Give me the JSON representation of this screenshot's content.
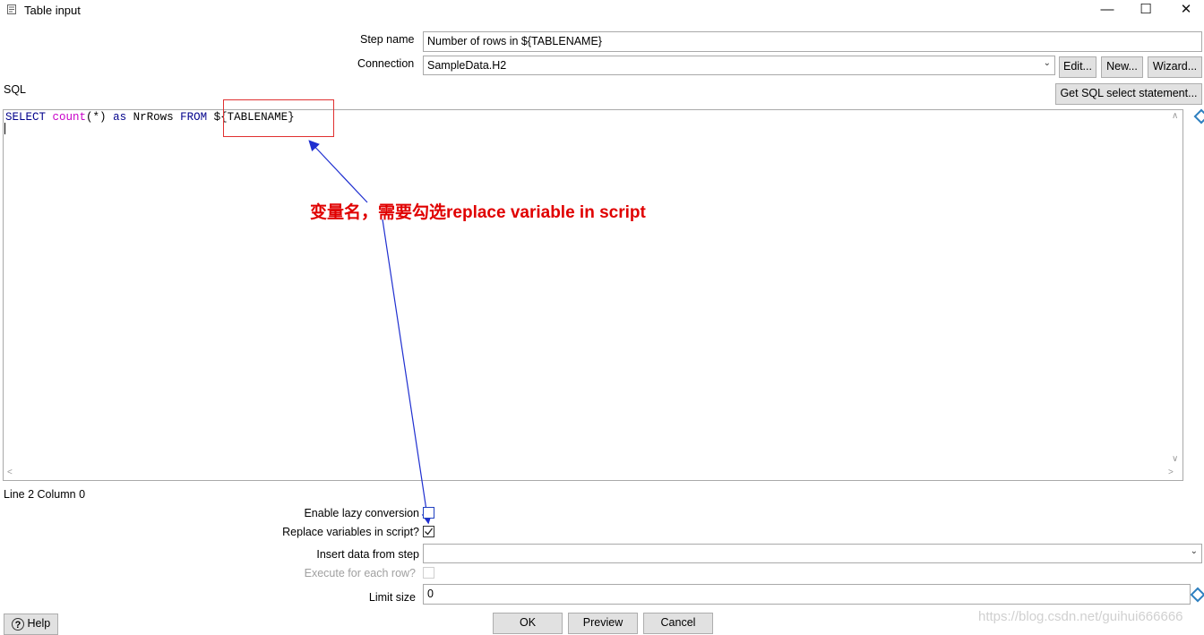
{
  "window": {
    "title": "Table input",
    "minimize": "—",
    "maximize": "☐",
    "close": "✕"
  },
  "form": {
    "step_name_label": "Step name",
    "step_name_value": "Number of rows in ${TABLENAME}",
    "connection_label": "Connection",
    "connection_value": "SampleData.H2",
    "edit_button": "Edit...",
    "new_button": "New...",
    "wizard_button": "Wizard...",
    "sql_label": "SQL",
    "get_sql_button": "Get SQL select statement..."
  },
  "editor": {
    "tokens": {
      "select": "SELECT",
      "count": "count",
      "paren": "(*)",
      "as": "as",
      "nrrows": "NrRows",
      "from": "FROM",
      "var": "${TABLENAME}"
    },
    "status": "Line 2 Column 0"
  },
  "annotation": {
    "text": "变量名，需要勾选replace variable in script"
  },
  "options": {
    "lazy_conversion_label": "Enable lazy conversion",
    "lazy_conversion_checked": false,
    "replace_variables_label": "Replace variables in script?",
    "replace_variables_checked": true,
    "insert_data_label": "Insert data from step",
    "insert_data_value": "",
    "execute_each_row_label": "Execute for each row?",
    "execute_each_row_checked": false,
    "limit_size_label": "Limit size",
    "limit_size_value": "0"
  },
  "footer": {
    "help_button": "Help",
    "ok_button": "OK",
    "preview_button": "Preview",
    "cancel_button": "Cancel"
  },
  "watermark": "https://blog.csdn.net/guihui666666",
  "colors": {
    "keyword": "#00008b",
    "function": "#c800c8",
    "annotation": "#e00000",
    "arrow": "#1f2fd0"
  }
}
